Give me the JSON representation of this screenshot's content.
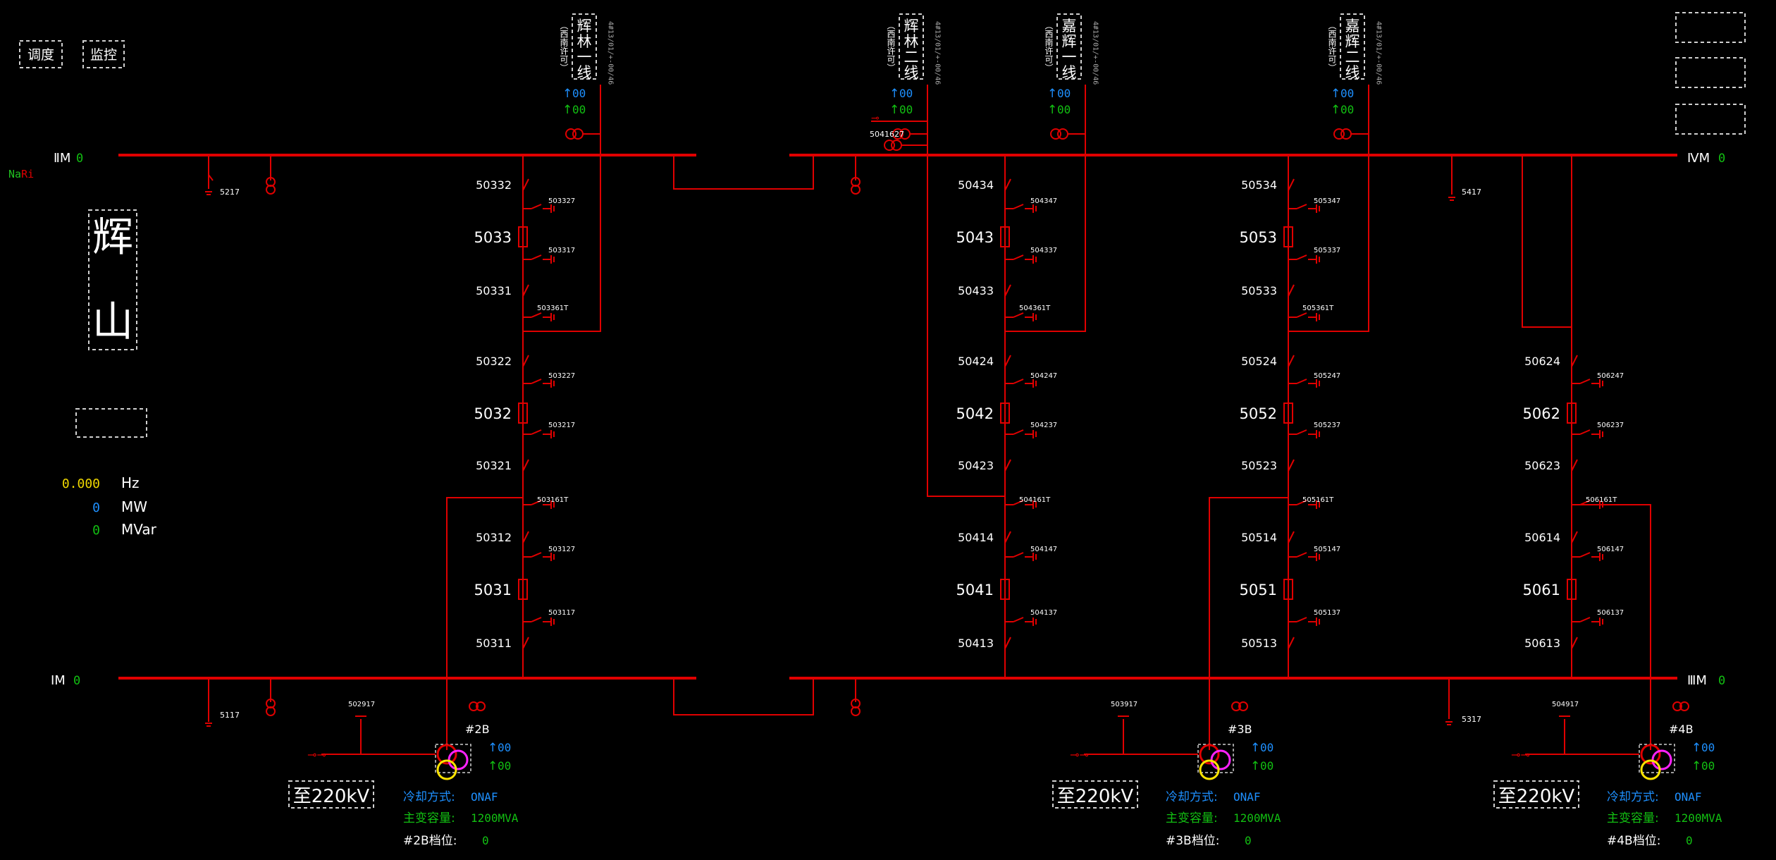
{
  "colors": {
    "background": "#000000",
    "busbar": "#e00000",
    "label": "#ffffff",
    "mw": "#1e90ff",
    "mvar": "#12c012",
    "hz": "#f0d800",
    "trans_yellow": "#ffe400",
    "trans_magenta": "#ff22ff"
  },
  "toolbar": {
    "dispatch": "调度",
    "monitor": "监控"
  },
  "station": {
    "name_top": "辉",
    "name_bottom": "山",
    "logo": "NARI"
  },
  "system_stats": {
    "hz_value": "0.000",
    "hz_unit": "Hz",
    "mw_value": "0",
    "mw_unit": "MW",
    "mvar_value": "0",
    "mvar_unit": "MVar"
  },
  "buses": {
    "bus2": {
      "label": "ⅡM",
      "value": "0"
    },
    "bus1": {
      "label": "ⅠM",
      "value": "0"
    },
    "bus4": {
      "label": "ⅣM",
      "value": "0"
    },
    "bus3": {
      "label": "ⅢM",
      "value": "0"
    }
  },
  "bus_pt_labels": {
    "pt5217": "5217",
    "pt5117": "5117",
    "pt5417": "5417",
    "pt5317": "5317"
  },
  "lines": [
    {
      "name": "辉林一线",
      "sub": "（西南许可）",
      "code": "4#13/01/+-00/46",
      "mw": "00",
      "mvar": "00"
    },
    {
      "name": "辉林二线",
      "sub": "（西南许可）",
      "code": "4#13/01/+-00/46",
      "mw": "00",
      "mvar": "00"
    },
    {
      "name": "嘉辉一线",
      "sub": "（西南许可）",
      "code": "4#13/01/+-00/46",
      "mw": "00",
      "mvar": "00"
    },
    {
      "name": "嘉辉二线",
      "sub": "（西南许可）",
      "code": "4#13/01/+-00/46",
      "mw": "00",
      "mvar": "00"
    }
  ],
  "line_ground_labels": {
    "l2": "5041627"
  },
  "bays": [
    {
      "id": "503",
      "breakers": [
        {
          "name": "5033",
          "top_sw": "50332",
          "top_es": "503327",
          "bot_es": "503317",
          "bot_sw": "50331"
        },
        {
          "name": "5032",
          "top_sw": "50322",
          "top_es": "503227",
          "bot_es": "503217",
          "bot_sw": "50321"
        },
        {
          "name": "5031",
          "top_sw": "50312",
          "top_es": "503127",
          "bot_es": "503117",
          "bot_sw": "50311"
        }
      ],
      "upper_tap_es": "503361T",
      "lower_tap_es": "503161T"
    },
    {
      "id": "504",
      "breakers": [
        {
          "name": "5043",
          "top_sw": "50434",
          "top_es": "504347",
          "bot_es": "504337",
          "bot_sw": "50433"
        },
        {
          "name": "5042",
          "top_sw": "50424",
          "top_es": "504247",
          "bot_es": "504237",
          "bot_sw": "50423"
        },
        {
          "name": "5041",
          "top_sw": "50414",
          "top_es": "504147",
          "bot_es": "504137",
          "bot_sw": "50413"
        }
      ],
      "upper_tap_es": "504361T",
      "lower_tap_es": "504161T"
    },
    {
      "id": "505",
      "breakers": [
        {
          "name": "5053",
          "top_sw": "50534",
          "top_es": "505347",
          "bot_es": "505337",
          "bot_sw": "50533"
        },
        {
          "name": "5052",
          "top_sw": "50524",
          "top_es": "505247",
          "bot_es": "505237",
          "bot_sw": "50523"
        },
        {
          "name": "5051",
          "top_sw": "50514",
          "top_es": "505147",
          "bot_es": "505137",
          "bot_sw": "50513"
        }
      ],
      "upper_tap_es": "505361T",
      "lower_tap_es": "505161T"
    },
    {
      "id": "506",
      "breakers": [
        {
          "name": "5062",
          "top_sw": "50624",
          "top_es": "506247",
          "bot_es": "506237",
          "bot_sw": "50623"
        },
        {
          "name": "5061",
          "top_sw": "50614",
          "top_es": "506147",
          "bot_es": "506137",
          "bot_sw": "50613"
        }
      ],
      "lower_tap_es": "506161T"
    }
  ],
  "transformers": [
    {
      "id": "#2B",
      "es": "502917",
      "to": "至220kV",
      "mw": "00",
      "mvar": "00",
      "cooling_label": "冷却方式:",
      "cooling": "ONAF",
      "capacity_label": "主变容量:",
      "capacity": "1200MVA",
      "tap_label": "#2B档位:",
      "tap": "0"
    },
    {
      "id": "#3B",
      "es": "503917",
      "to": "至220kV",
      "mw": "00",
      "mvar": "00",
      "cooling_label": "冷却方式:",
      "cooling": "ONAF",
      "capacity_label": "主变容量:",
      "capacity": "1200MVA",
      "tap_label": "#3B档位:",
      "tap": "0"
    },
    {
      "id": "#4B",
      "es": "504917",
      "to": "至220kV",
      "mw": "00",
      "mvar": "00",
      "cooling_label": "冷却方式:",
      "cooling": "ONAF",
      "capacity_label": "主变容量:",
      "capacity": "1200MVA",
      "tap_label": "#4B档位:",
      "tap": "0"
    }
  ]
}
